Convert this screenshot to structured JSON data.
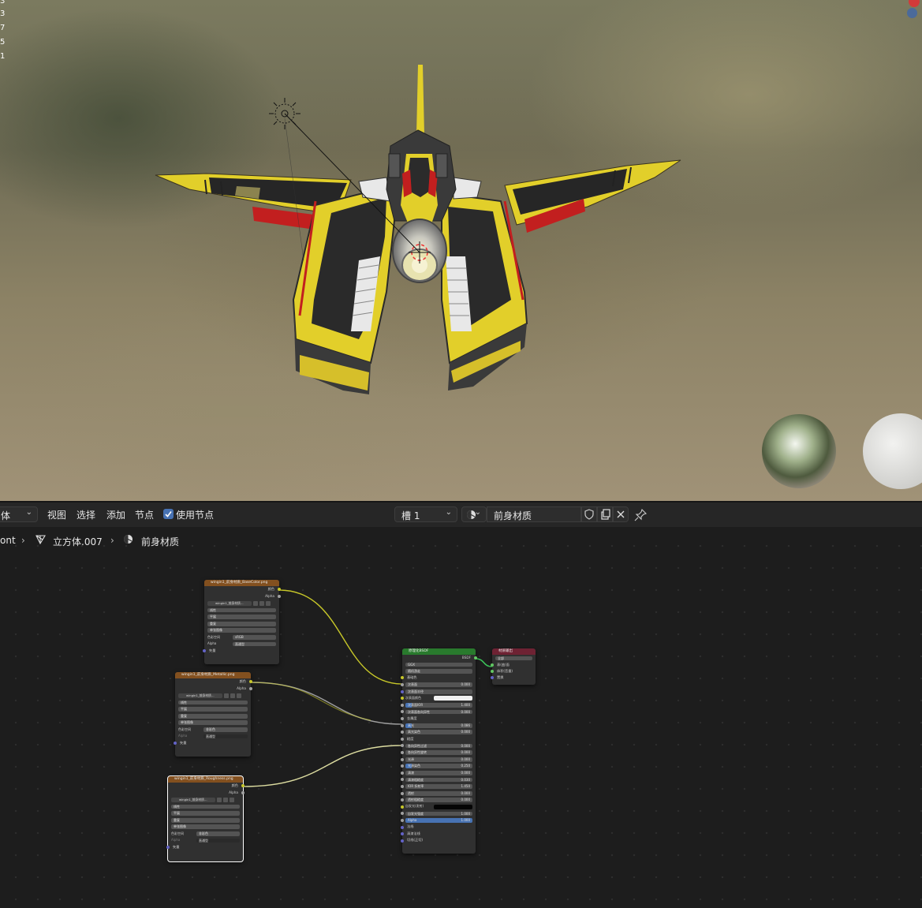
{
  "viewport": {
    "stats": [
      "3",
      "3",
      "7",
      "5",
      "1"
    ]
  },
  "header": {
    "mode_dropdown": "体",
    "menu_view": "视图",
    "menu_select": "选择",
    "menu_add": "添加",
    "menu_node": "节点",
    "use_nodes_label": "使用节点",
    "use_nodes_checked": true,
    "slot_dropdown": "槽 1",
    "material_name": "前身材质"
  },
  "breadcrumb": {
    "item1": "ont",
    "item2": "立方体.007",
    "item3": "前身材质"
  },
  "nodes": {
    "tex1": {
      "title": "wingin1_前身材质_BaseColor.png",
      "out_color": "颜色",
      "out_alpha": "Alpha",
      "image_name": "wingin1_前身材质...",
      "interp": "线性",
      "proj": "平展",
      "ext": "重复",
      "source": "单张图像",
      "colorspace_label": "色彩空间",
      "colorspace_value": "sRGB",
      "alpha_label": "Alpha",
      "alpha_value": "直通型",
      "vector": "矢量"
    },
    "tex2": {
      "title": "wingin1_前身材质_Metallic.png",
      "out_color": "颜色",
      "out_alpha": "Alpha",
      "image_name": "wingin1_前身材质...",
      "interp": "线性",
      "proj": "平展",
      "ext": "重复",
      "source": "单张图像",
      "colorspace_label": "色彩空间",
      "colorspace_value": "非彩色",
      "alpha_label": "Alpha",
      "alpha_value": "直通型",
      "vector": "矢量"
    },
    "tex3": {
      "title": "wingin1_前身材质_Roughness.png",
      "out_color": "颜色",
      "out_alpha": "Alpha",
      "image_name": "wingin1_前身材质...",
      "interp": "线性",
      "proj": "平展",
      "ext": "重复",
      "source": "单张图像",
      "colorspace_label": "色彩空间",
      "colorspace_value": "非彩色",
      "alpha_label": "Alpha",
      "alpha_value": "直通型",
      "vector": "矢量"
    },
    "bsdf": {
      "title": "原理化BSDF",
      "out": "BSDF",
      "distribution": "GGX",
      "subsurface_method": "随机游走",
      "rows": [
        {
          "label": "基础色",
          "type": "socket"
        },
        {
          "label": "次表面",
          "value": "0.000",
          "type": "field"
        },
        {
          "label": "次表面半径",
          "type": "dropdown"
        },
        {
          "label": "次表面颜色",
          "type": "color-white"
        },
        {
          "label": "次表面IOR",
          "value": "1.400",
          "type": "field-blue"
        },
        {
          "label": "次表面各向异性",
          "value": "0.000",
          "type": "field"
        },
        {
          "label": "金属度",
          "type": "socket"
        },
        {
          "label": "高光",
          "value": "0.086",
          "type": "field-blue"
        },
        {
          "label": "高光染色",
          "value": "0.000",
          "type": "field"
        },
        {
          "label": "糙度",
          "type": "socket"
        },
        {
          "label": "各向异性过滤",
          "value": "0.000",
          "type": "field"
        },
        {
          "label": "各向异性旋转",
          "value": "0.000",
          "type": "field"
        },
        {
          "label": "光泽",
          "value": "0.000",
          "type": "field"
        },
        {
          "label": "光泽染色",
          "value": "0.250",
          "type": "field-blue"
        },
        {
          "label": "清漆",
          "value": "0.000",
          "type": "field"
        },
        {
          "label": "清漆粗糙度",
          "value": "0.030",
          "type": "field"
        },
        {
          "label": "IOR 折射率",
          "value": "1.450",
          "type": "field"
        },
        {
          "label": "透射",
          "value": "0.000",
          "type": "field"
        },
        {
          "label": "透射粗糙度",
          "value": "0.000",
          "type": "field"
        },
        {
          "label": "自发光(发射)",
          "type": "color-black"
        },
        {
          "label": "自发光强度",
          "value": "1.000",
          "type": "field"
        },
        {
          "label": "Alpha",
          "value": "1.000",
          "type": "field-blue-full"
        },
        {
          "label": "法线",
          "type": "socket"
        },
        {
          "label": "清漆法线",
          "type": "socket"
        },
        {
          "label": "切线(正切)",
          "type": "socket"
        }
      ]
    },
    "output": {
      "title": "材质输出",
      "target": "全部",
      "in_surface": "表(曲)面",
      "in_volume": "体积(音量)",
      "in_disp": "置换"
    }
  }
}
